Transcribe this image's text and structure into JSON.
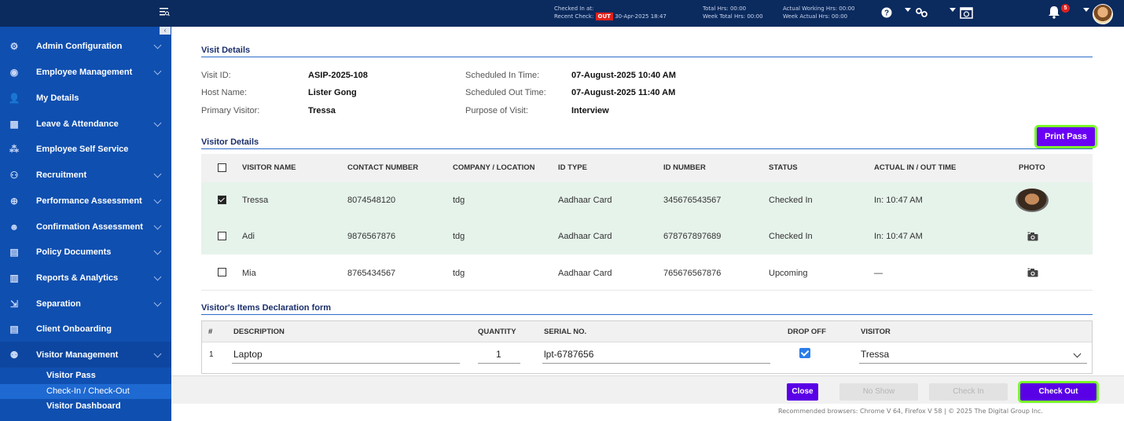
{
  "topbar": {
    "checked_in_label": "Checked In at:",
    "recent_check_label": "Recent Check:",
    "out_badge": "OUT",
    "recent_check_time": "30-Apr-2025 18:47",
    "total_hrs": "Total Hrs: 00:00",
    "week_total_hrs": "Week Total Hrs: 00:00",
    "actual_working_hrs": "Actual Working Hrs: 00:00",
    "week_actual_hrs": "Week Actual Hrs: 00:00",
    "notification_count": "5"
  },
  "sidebar": {
    "items": [
      {
        "label": "Admin Configuration",
        "icon": "gear-icon",
        "glyph": "⚙",
        "chevron": true
      },
      {
        "label": "Employee Management",
        "icon": "employee-icon",
        "glyph": "◉",
        "chevron": true
      },
      {
        "label": "My Details",
        "icon": "user-icon",
        "glyph": "👤",
        "chevron": false
      },
      {
        "label": "Leave & Attendance",
        "icon": "calendar-icon",
        "glyph": "▦",
        "chevron": true
      },
      {
        "label": "Employee Self Service",
        "icon": "self-service-icon",
        "glyph": "⁂",
        "chevron": false
      },
      {
        "label": "Recruitment",
        "icon": "recruitment-icon",
        "glyph": "⚇",
        "chevron": true
      },
      {
        "label": "Performance Assessment",
        "icon": "performance-icon",
        "glyph": "⊕",
        "chevron": true
      },
      {
        "label": "Confirmation Assessment",
        "icon": "confirmation-icon",
        "glyph": "☻",
        "chevron": true
      },
      {
        "label": "Policy Documents",
        "icon": "document-icon",
        "glyph": "▤",
        "chevron": true
      },
      {
        "label": "Reports & Analytics",
        "icon": "analytics-icon",
        "glyph": "▥",
        "chevron": true
      },
      {
        "label": "Separation",
        "icon": "separation-icon",
        "glyph": "⇲",
        "chevron": true
      },
      {
        "label": "Client Onboarding",
        "icon": "onboarding-icon",
        "glyph": "▤",
        "chevron": false
      },
      {
        "label": "Visitor Management",
        "icon": "visitor-icon",
        "glyph": "⚉",
        "chevron": true
      }
    ],
    "sub_items": [
      {
        "label": "Visitor Pass"
      },
      {
        "label": "Check-In / Check-Out"
      },
      {
        "label": "Visitor Dashboard"
      }
    ]
  },
  "visit_details": {
    "title": "Visit Details",
    "visit_id_label": "Visit ID:",
    "visit_id": "ASIP-2025-108",
    "host_name_label": "Host Name:",
    "host_name": "Lister Gong",
    "primary_visitor_label": "Primary Visitor:",
    "primary_visitor": "Tressa",
    "scheduled_in_label": "Scheduled In Time:",
    "scheduled_in": "07-August-2025 10:40 AM",
    "scheduled_out_label": "Scheduled Out Time:",
    "scheduled_out": "07-August-2025 11:40 AM",
    "purpose_label": "Purpose of Visit:",
    "purpose": "Interview"
  },
  "visitor_details": {
    "title": "Visitor Details",
    "print_pass_label": "Print Pass",
    "columns": [
      "VISITOR NAME",
      "CONTACT NUMBER",
      "COMPANY / LOCATION",
      "ID TYPE",
      "ID NUMBER",
      "STATUS",
      "ACTUAL IN / OUT TIME",
      "PHOTO"
    ],
    "rows": [
      {
        "checked": true,
        "name": "Tressa",
        "contact": "8074548120",
        "company": "tdg",
        "id_type": "Aadhaar Card",
        "id_number": "345676543567",
        "status": "Checked In",
        "time": "In: 10:47 AM",
        "photo": "avatar"
      },
      {
        "checked": false,
        "name": "Adi",
        "contact": "9876567876",
        "company": "tdg",
        "id_type": "Aadhaar Card",
        "id_number": "678767897689",
        "status": "Checked In",
        "time": "In: 10:47 AM",
        "photo": "camera"
      },
      {
        "checked": false,
        "name": "Mia",
        "contact": "8765434567",
        "company": "tdg",
        "id_type": "Aadhaar Card",
        "id_number": "765676567876",
        "status": "Upcoming",
        "time": "—",
        "photo": "camera"
      }
    ]
  },
  "items_form": {
    "title": "Visitor's Items Declaration form",
    "columns": [
      "#",
      "DESCRIPTION",
      "QUANTITY",
      "SERIAL NO.",
      "DROP OFF",
      "VISITOR"
    ],
    "rows": [
      {
        "index": "1",
        "description": "Laptop",
        "quantity": "1",
        "serial": "lpt-6787656",
        "drop_off": true,
        "visitor": "Tressa"
      }
    ]
  },
  "actions": {
    "close": "Close",
    "no_show": "No Show",
    "check_in": "Check In",
    "check_out": "Check Out"
  },
  "footer": {
    "text": "Recommended browsers: Chrome V 64, Firefox V 58  |  © 2025 The Digital Group Inc."
  },
  "colors": {
    "topbar": "#0b2a5e",
    "sidebar": "#0f4fb0",
    "accent_purple": "#5a00e6",
    "highlight_green": "#7bff2a",
    "row_green": "#e6f3eb"
  }
}
